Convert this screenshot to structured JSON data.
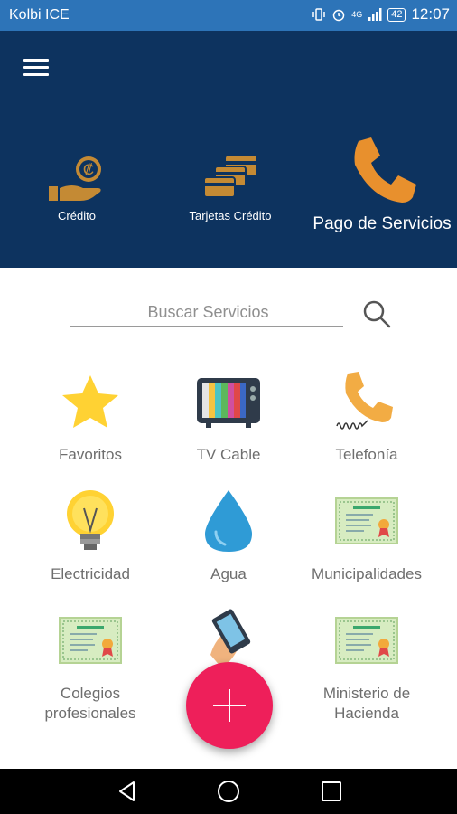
{
  "status_bar": {
    "carrier": "Kolbi ICE",
    "network": "4G",
    "battery": "42",
    "time": "12:07"
  },
  "header": {
    "tabs": [
      {
        "label": "Crédito",
        "icon": "hand-coin-icon"
      },
      {
        "label": "Tarjetas Crédito",
        "icon": "credit-cards-icon"
      },
      {
        "label": "Pago de Servicios",
        "icon": "phone-icon",
        "active": true
      }
    ]
  },
  "search": {
    "placeholder": "Buscar Servicios",
    "value": ""
  },
  "services": [
    {
      "label": "Favoritos",
      "icon": "star-icon"
    },
    {
      "label": "TV Cable",
      "icon": "tv-icon"
    },
    {
      "label": "Telefonía",
      "icon": "telephone-icon"
    },
    {
      "label": "Electricidad",
      "icon": "lightbulb-icon"
    },
    {
      "label": "Agua",
      "icon": "water-drop-icon"
    },
    {
      "label": "Municipalidades",
      "icon": "certificate-icon"
    },
    {
      "label": "Colegios profesionales",
      "icon": "certificate-icon"
    },
    {
      "label": "",
      "icon": "mobile-hand-icon"
    },
    {
      "label": "Ministerio de Hacienda",
      "icon": "certificate-icon"
    }
  ],
  "colors": {
    "status_bar": "#2d74b8",
    "header": "#0d335f",
    "accent_orange": "#e8902d",
    "fab": "#ee1f5a"
  }
}
